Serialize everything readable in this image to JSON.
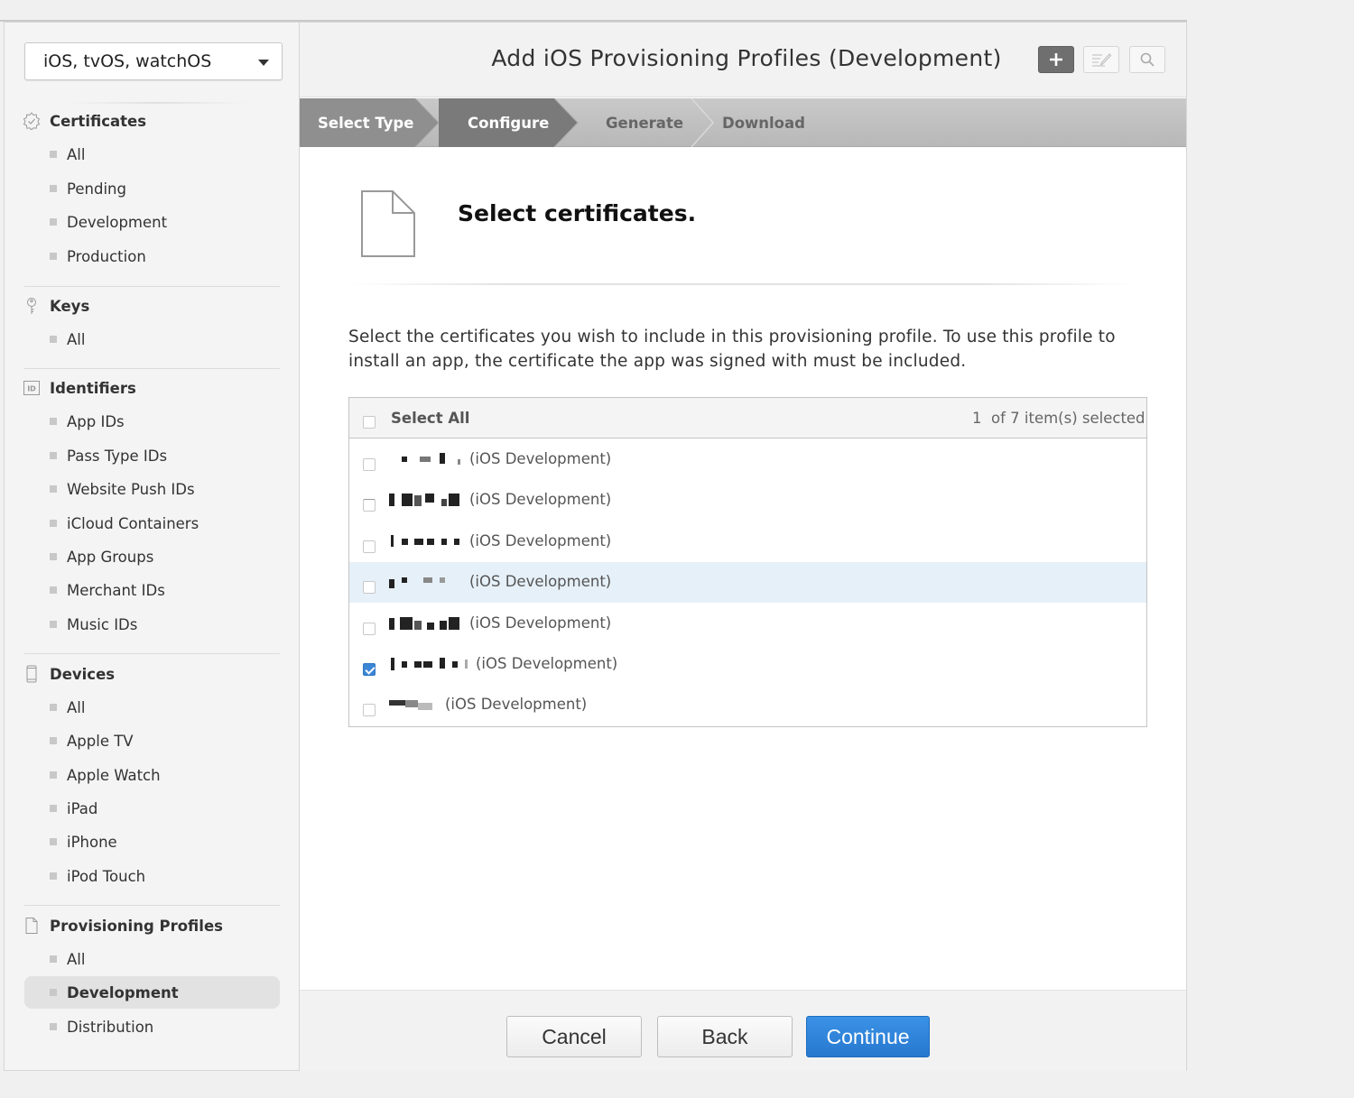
{
  "sidebar": {
    "platform": "iOS, tvOS, watchOS",
    "sections": [
      {
        "title": "Certificates",
        "icon": "certificate-badge-icon",
        "items": [
          "All",
          "Pending",
          "Development",
          "Production"
        ]
      },
      {
        "title": "Keys",
        "icon": "key-icon",
        "items": [
          "All"
        ]
      },
      {
        "title": "Identifiers",
        "icon": "id-icon",
        "items": [
          "App IDs",
          "Pass Type IDs",
          "Website Push IDs",
          "iCloud Containers",
          "App Groups",
          "Merchant IDs",
          "Music IDs"
        ]
      },
      {
        "title": "Devices",
        "icon": "device-icon",
        "items": [
          "All",
          "Apple TV",
          "Apple Watch",
          "iPad",
          "iPhone",
          "iPod Touch"
        ]
      },
      {
        "title": "Provisioning Profiles",
        "icon": "document-icon",
        "items": [
          "All",
          "Development",
          "Distribution"
        ]
      }
    ],
    "active_item": "Provisioning Profiles / Development"
  },
  "header": {
    "title": "Add iOS Provisioning Profiles (Development)",
    "buttons": [
      "add-icon",
      "edit-icon",
      "search-icon"
    ]
  },
  "steps": [
    {
      "label": "Select Type",
      "state": "done"
    },
    {
      "label": "Configure",
      "state": "current"
    },
    {
      "label": "Generate",
      "state": "todo"
    },
    {
      "label": "Download",
      "state": "todo"
    }
  ],
  "content": {
    "heading": "Select certificates.",
    "description": "Select the certificates you wish to include in this provisioning profile. To use this profile to install an app, the certificate the app was signed with must be included.",
    "select_all_label": "Select All",
    "selected_count": "1",
    "count_suffix": "of 7 item(s) selected",
    "certificates": [
      {
        "type": "(iOS Development)",
        "checked": false,
        "highlighted": false
      },
      {
        "type": "(iOS Development)",
        "checked": false,
        "highlighted": false
      },
      {
        "type": "(iOS Development)",
        "checked": false,
        "highlighted": false
      },
      {
        "type": "(iOS Development)",
        "checked": false,
        "highlighted": true
      },
      {
        "type": "(iOS Development)",
        "checked": false,
        "highlighted": false
      },
      {
        "type": "(iOS Development)",
        "checked": true,
        "highlighted": false
      },
      {
        "type": "(iOS Development)",
        "checked": false,
        "highlighted": false
      }
    ]
  },
  "footer": {
    "cancel": "Cancel",
    "back": "Back",
    "continue": "Continue"
  },
  "colors": {
    "primary_button": "#2f80d8",
    "checkbox_checked": "#3b86d5",
    "row_highlight": "#e6f0f8",
    "step_done": "#8f8f8f",
    "step_current": "#7a7a7a"
  }
}
